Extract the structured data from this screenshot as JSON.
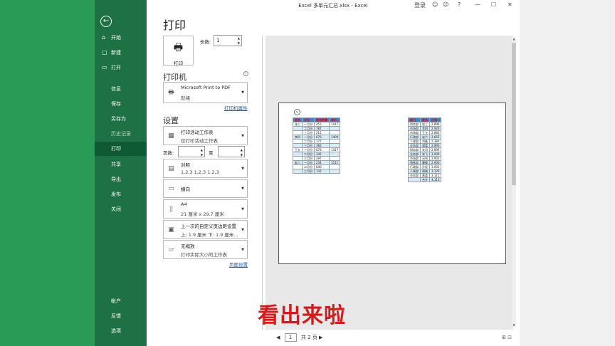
{
  "window": {
    "title": "Excel 多单元汇总.xlsx - Excel",
    "login": "登录",
    "controls": [
      "☺",
      "☹",
      "?",
      "—",
      "☐",
      "✕"
    ]
  },
  "nav": {
    "back": "←",
    "items": [
      {
        "icon": "⌂",
        "label": "开始"
      },
      {
        "icon": "▢",
        "label": "新建"
      },
      {
        "icon": "▭",
        "label": "打开"
      },
      {
        "icon": "",
        "label": "信息"
      },
      {
        "icon": "",
        "label": "保存"
      },
      {
        "icon": "",
        "label": "另存为"
      },
      {
        "icon": "",
        "label": "历史记录"
      },
      {
        "icon": "",
        "label": "打印"
      },
      {
        "icon": "",
        "label": "共享"
      },
      {
        "icon": "",
        "label": "导出"
      },
      {
        "icon": "",
        "label": "发布"
      },
      {
        "icon": "",
        "label": "关闭"
      },
      {
        "icon": "",
        "label": "帐户"
      },
      {
        "icon": "",
        "label": "反馈"
      },
      {
        "icon": "",
        "label": "选项"
      }
    ],
    "active": "打印"
  },
  "print": {
    "heading": "打印",
    "button_label": "打印",
    "copies_label": "份数:",
    "copies_value": "1",
    "printer_section": "打印机",
    "printer_name": "Microsoft Print to PDF",
    "printer_status": "就绪",
    "printer_props": "打印机属性",
    "settings_section": "设置",
    "scope_title": "打印活动工作表",
    "scope_desc": "仅打印活动工作表",
    "pages_label": "页数:",
    "to_label": "至",
    "collate_title": "对照",
    "collate_desc": "1,2,3    1,2,3    1,2,3",
    "orientation": "横向",
    "paper_title": "A4",
    "paper_desc": "21 厘米 x 29.7 厘米",
    "margins_title": "上一次的自定义页边距设置",
    "margins_desc": "上: 1.9 厘米 下: 1.9 厘米...",
    "scale_title": "无缩放",
    "scale_desc": "打印实际大小的工作表",
    "page_setup": "页面设置"
  },
  "preview": {
    "table1": {
      "header": [
        "姓名",
        "月份",
        "销售数量",
        "单价"
      ],
      "rows": [
        [
          "张三",
          "一月份",
          "453",
          "1417"
        ],
        [
          "",
          "二月份",
          "787",
          ""
        ],
        [
          "",
          "三月份",
          "211",
          ""
        ],
        [
          "李四",
          "一月份",
          "676",
          "1409"
        ],
        [
          "",
          "二月份",
          "177",
          ""
        ],
        [
          "",
          "三月份",
          "383",
          ""
        ],
        [
          "王五",
          "一月份",
          "878",
          "1417"
        ],
        [
          "",
          "二月份",
          "242",
          ""
        ],
        [
          "",
          "三月份",
          "297",
          ""
        ],
        [
          "赵六",
          "一月份",
          "234",
          "1511"
        ],
        [
          "",
          "二月份",
          "640",
          ""
        ],
        [
          "",
          "三月份",
          "132",
          ""
        ]
      ]
    },
    "table2": {
      "header": [
        "部门",
        "姓名",
        "工资"
      ],
      "rows": [
        [
          "财务部",
          "张三",
          "2,898"
        ],
        [
          "市场部",
          "李四",
          "2,920"
        ],
        [
          "市场部",
          "王五",
          "2,883"
        ],
        [
          "行政部",
          "赵六",
          "2,665"
        ],
        [
          "人事部",
          "刘备",
          "2,380"
        ],
        [
          "业务部",
          "诸葛",
          "2,893"
        ],
        [
          "财务部",
          "关羽",
          "2,899"
        ],
        [
          "业务部",
          "张飞",
          "3,009"
        ],
        [
          "市场部",
          "吕布",
          "2,903"
        ],
        [
          "销售部",
          "曹操",
          "2,906"
        ],
        [
          "行政部",
          "孙权",
          "3,003"
        ],
        [
          "人事部",
          "周瑜",
          "3,126"
        ],
        [
          "业务部",
          "黄盖",
          "3,111"
        ],
        [
          "",
          "合计",
          "4,110"
        ]
      ]
    }
  },
  "pager": {
    "prev": "◀",
    "page": "1",
    "total": "共 2 页",
    "next": "▶"
  },
  "subtitle": "看出来啦"
}
